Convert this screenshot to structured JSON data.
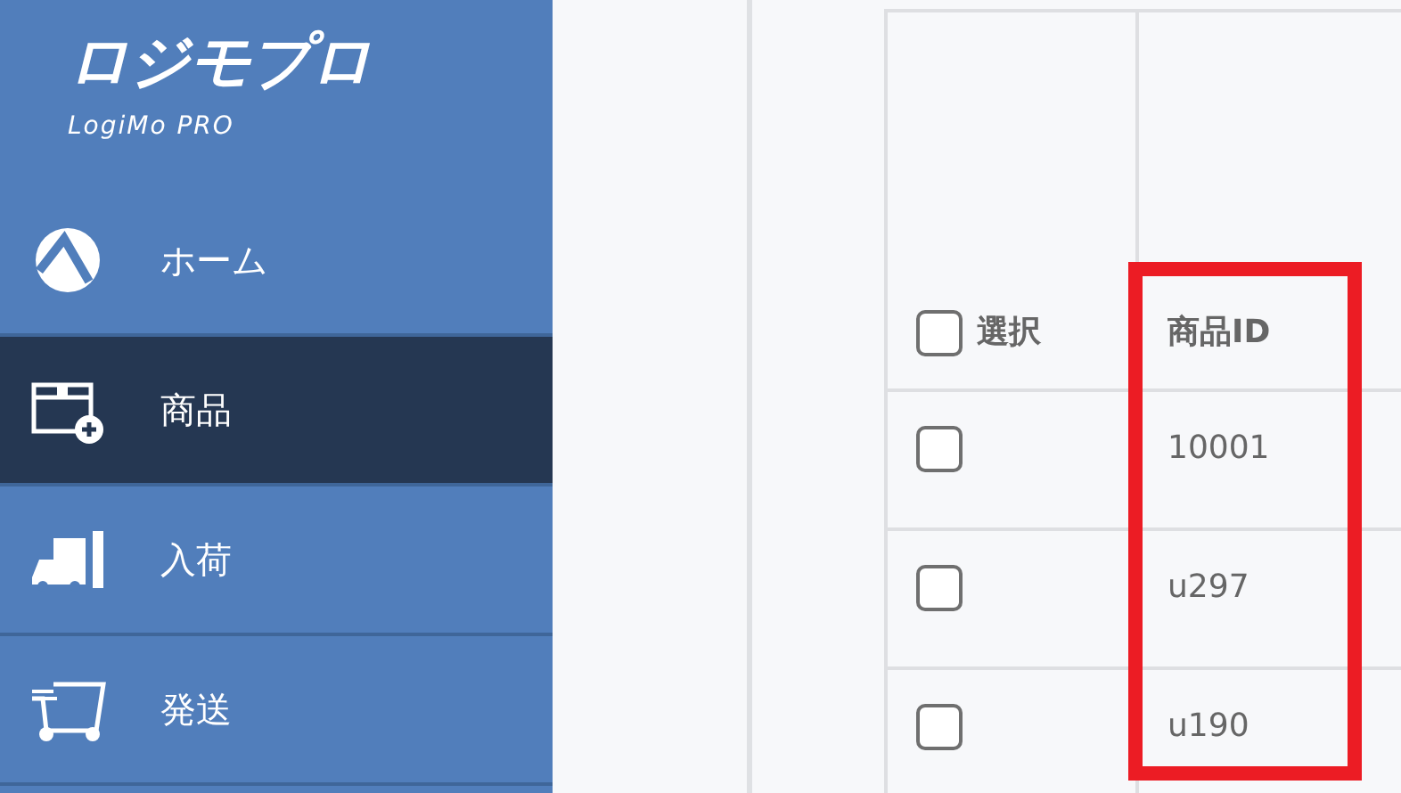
{
  "logo": {
    "title": "ロジモプロ",
    "subtitle": "LogiMo PRO"
  },
  "sidebar": {
    "items": [
      {
        "label": "ホーム",
        "kind": "home",
        "selected": false
      },
      {
        "label": "商品",
        "kind": "product",
        "selected": true
      },
      {
        "label": "入荷",
        "kind": "arrival",
        "selected": false
      },
      {
        "label": "発送",
        "kind": "shipping",
        "selected": false
      }
    ]
  },
  "table": {
    "select_all": {
      "label": "選択",
      "checked": false
    },
    "columns": [
      {
        "label": "商品ID",
        "highlighted": true
      }
    ],
    "rows": [
      {
        "checked": false,
        "cells": [
          "10001"
        ]
      },
      {
        "checked": false,
        "cells": [
          "u297"
        ]
      },
      {
        "checked": false,
        "cells": [
          "u190"
        ]
      }
    ]
  }
}
